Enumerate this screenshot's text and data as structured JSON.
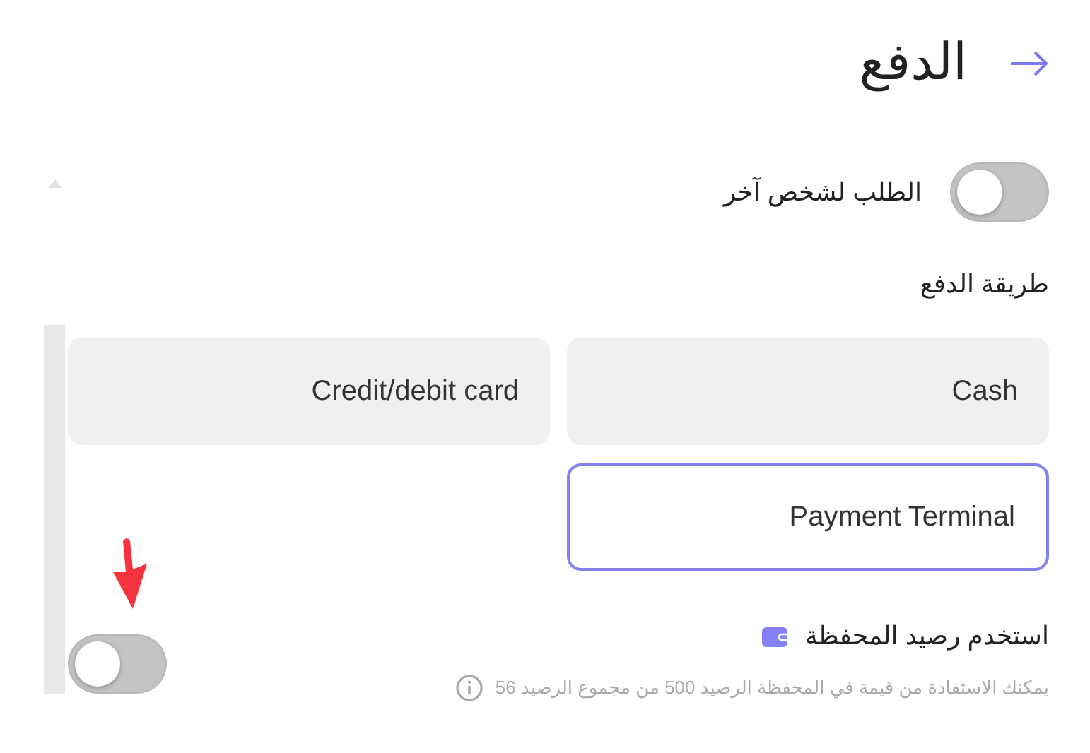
{
  "header": {
    "title": "الدفع"
  },
  "order_for_other": {
    "label": "الطلب لشخص آخر",
    "on": false
  },
  "payment_method": {
    "label": "طريقة الدفع",
    "options": [
      {
        "label": "Cash",
        "selected": false
      },
      {
        "label": "Credit/debit card",
        "selected": false
      },
      {
        "label": "Payment Terminal",
        "selected": true
      }
    ]
  },
  "wallet": {
    "label": "استخدم رصيد المحفظة",
    "on": false,
    "note": "يمكنك الاستفادة من قيمة في المحفظة الرصيد 500 من مجموع الرصيد 56"
  }
}
